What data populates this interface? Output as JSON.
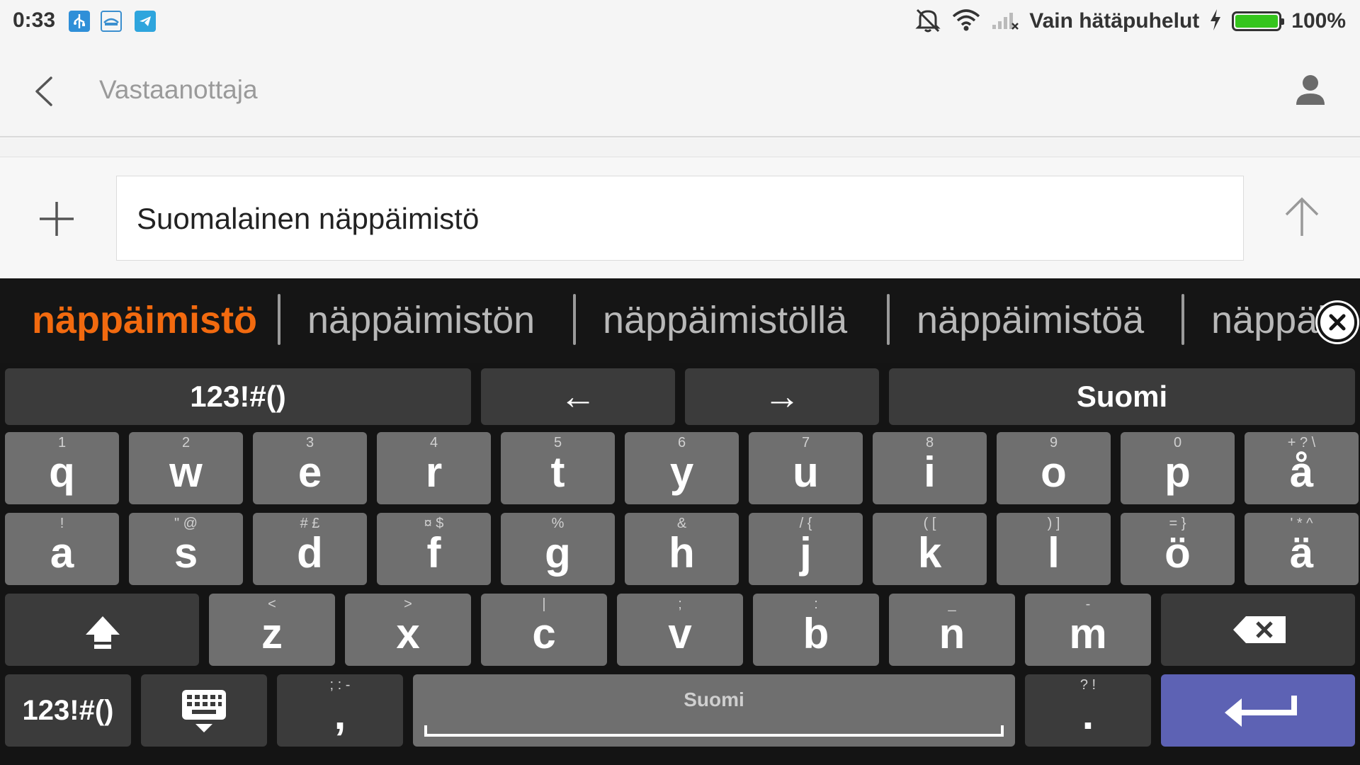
{
  "status_bar": {
    "time": "0:33",
    "notification_icons": [
      "usb-icon",
      "wifi-hotspot-app-icon",
      "telegram-icon"
    ],
    "network_status": "Vain hätäpuhelut",
    "battery_percent": "100%",
    "battery_level": 1.0,
    "battery_color": "#35c51d"
  },
  "header": {
    "recipient_placeholder": "Vastaanottaja"
  },
  "compose": {
    "message_text": "Suomalainen näppäimistö"
  },
  "keyboard": {
    "suggestions": [
      "näppäimistö",
      "näppäimistön",
      "näppäimistöllä",
      "näppäimistöä",
      "näppäi"
    ],
    "primary_color": "#f26a0f",
    "top_row": {
      "symbols_label": "123!#()",
      "left_arrow": "←",
      "right_arrow": "→",
      "language_label": "Suomi"
    },
    "row1": [
      {
        "hint": "1",
        "key": "q"
      },
      {
        "hint": "2",
        "key": "w"
      },
      {
        "hint": "3",
        "key": "e"
      },
      {
        "hint": "4",
        "key": "r"
      },
      {
        "hint": "5",
        "key": "t"
      },
      {
        "hint": "6",
        "key": "y"
      },
      {
        "hint": "7",
        "key": "u"
      },
      {
        "hint": "8",
        "key": "i"
      },
      {
        "hint": "9",
        "key": "o"
      },
      {
        "hint": "0",
        "key": "p"
      },
      {
        "hint": "+ ? \\",
        "key": "å"
      }
    ],
    "row2": [
      {
        "hint": "!",
        "key": "a"
      },
      {
        "hint": "\" @",
        "key": "s"
      },
      {
        "hint": "# £",
        "key": "d"
      },
      {
        "hint": "¤ $",
        "key": "f"
      },
      {
        "hint": "%",
        "key": "g"
      },
      {
        "hint": "&",
        "key": "h"
      },
      {
        "hint": "/ {",
        "key": "j"
      },
      {
        "hint": "( [",
        "key": "k"
      },
      {
        "hint": ") ]",
        "key": "l"
      },
      {
        "hint": "= }",
        "key": "ö"
      },
      {
        "hint": "' * ^",
        "key": "ä"
      }
    ],
    "row3": [
      {
        "hint": "<",
        "key": "z"
      },
      {
        "hint": ">",
        "key": "x"
      },
      {
        "hint": "|",
        "key": "c"
      },
      {
        "hint": ";",
        "key": "v"
      },
      {
        "hint": ":",
        "key": "b"
      },
      {
        "hint": "_",
        "key": "n"
      },
      {
        "hint": "-",
        "key": "m"
      }
    ],
    "bottom_row": {
      "symbols_label": "123!#()",
      "comma_hint": "; : -",
      "comma": ",",
      "space_label": "Suomi",
      "period_hint": "? !",
      "period": ".",
      "enter_color": "#5d62b4"
    }
  }
}
